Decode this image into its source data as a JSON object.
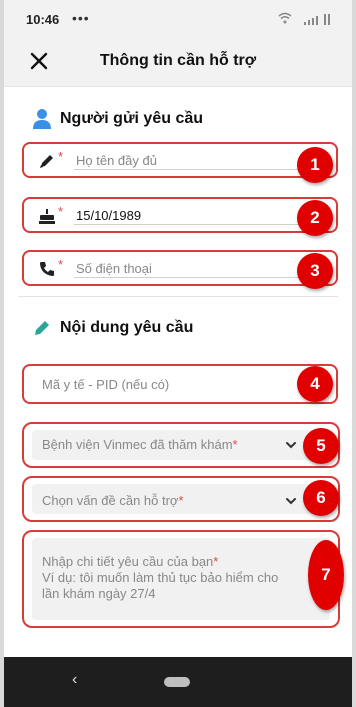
{
  "status": {
    "time": "10:46",
    "dots": "•••"
  },
  "header": {
    "title": "Thông tin cần hỗ trợ"
  },
  "sender": {
    "heading": "Người gửi yêu cầu",
    "full_name_placeholder": "Họ tên đầy đủ",
    "birth_date_value": "15/10/1989",
    "phone_placeholder": "Số điện thoại",
    "required_mark": "*"
  },
  "content": {
    "heading": "Nội dung yêu cầu",
    "pid_placeholder": "Mã y tế - PID (nếu có)",
    "hospital_placeholder": "Bệnh viện Vinmec đã thăm khám",
    "issue_placeholder": "Chọn vấn đề cần hỗ trợ",
    "details_placeholder": "Nhập chi tiết yêu cầu của bạn",
    "details_example": "Ví dụ: tôi muốn làm thủ tục bảo hiểm cho lần khám ngày 27/4",
    "required_mark": "*"
  },
  "markers": [
    "1",
    "2",
    "3",
    "4",
    "5",
    "6",
    "7"
  ],
  "nav": {
    "back_glyph": "‹"
  },
  "colors": {
    "marker": "#e00000",
    "outline": "#d93a3a",
    "required": "#e04848",
    "person_icon": "#3b8fe6",
    "pencil_icon": "#2aa59a"
  }
}
